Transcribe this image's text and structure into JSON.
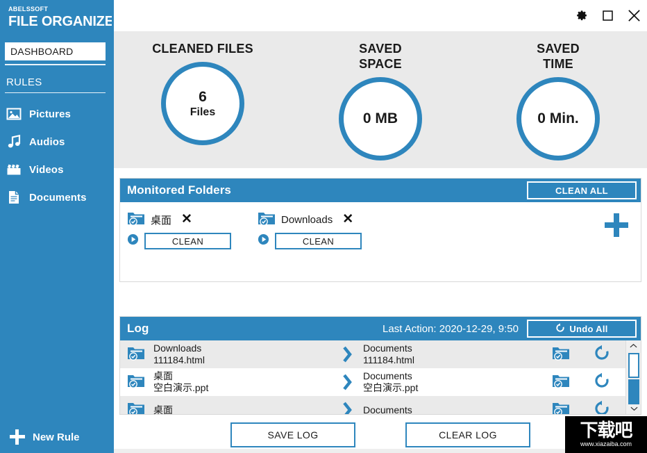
{
  "brand": {
    "small": "ABELSSOFT",
    "big": "FILE ORGANIZER"
  },
  "sidebar": {
    "dashboard_label": "DASHBOARD",
    "rules_label": "RULES",
    "items": [
      {
        "label": "Pictures",
        "icon": "picture-icon"
      },
      {
        "label": "Audios",
        "icon": "music-note-icon"
      },
      {
        "label": "Videos",
        "icon": "clapperboard-icon"
      },
      {
        "label": "Documents",
        "icon": "document-icon"
      }
    ],
    "new_rule_label": "New Rule"
  },
  "titlebar": {
    "settings_icon": "gear-icon",
    "maximize_icon": "square-icon",
    "close_icon": "close-icon"
  },
  "stats": [
    {
      "title": "CLEANED FILES",
      "value": "6",
      "unit": "Files"
    },
    {
      "title": "SAVED\nSPACE",
      "title_line1": "SAVED",
      "title_line2": "SPACE",
      "value": "0 MB",
      "unit": ""
    },
    {
      "title": "SAVED\nTIME",
      "title_line1": "SAVED",
      "title_line2": "TIME",
      "value": "0 Min.",
      "unit": ""
    }
  ],
  "monitored": {
    "title": "Monitored Folders",
    "clean_all_label": "CLEAN ALL",
    "add_icon": "plus-icon",
    "folders": [
      {
        "name": "桌面",
        "clean_label": "CLEAN",
        "remove_label": "✕",
        "play_icon": "play-icon",
        "folder_icon": "folder-check-icon"
      },
      {
        "name": "Downloads",
        "clean_label": "CLEAN",
        "remove_label": "✕",
        "play_icon": "play-icon",
        "folder_icon": "folder-check-icon"
      }
    ]
  },
  "log": {
    "title": "Log",
    "last_action": "Last Action: 2020-12-29, 9:50",
    "undo_all_label": "Undo All",
    "undo_icon": "undo-icon",
    "rows": [
      {
        "source_folder": "Downloads",
        "source_file": "111184.html",
        "target_folder": "Documents",
        "target_file": "111184.html",
        "arrow_icon": "chevron-right-icon",
        "folder_icon": "folder-check-icon",
        "revert_icon": "revert-icon"
      },
      {
        "source_folder": "桌面",
        "source_file": "空白演示.ppt",
        "target_folder": "Documents",
        "target_file": "空白演示.ppt",
        "arrow_icon": "chevron-right-icon",
        "folder_icon": "folder-check-icon",
        "revert_icon": "revert-icon"
      },
      {
        "source_folder": "桌面",
        "source_file": "",
        "target_folder": "Documents",
        "target_file": "",
        "arrow_icon": "chevron-right-icon",
        "folder_icon": "folder-check-icon",
        "revert_icon": "revert-icon"
      }
    ],
    "scroll_up_icon": "chevron-up-icon",
    "scroll_down_icon": "chevron-down-icon"
  },
  "footer": {
    "save_log_label": "SAVE LOG",
    "clear_log_label": "CLEAR LOG"
  },
  "watermark": {
    "text_cn": "下载吧",
    "url": "www.xiazaiba.com"
  },
  "colors": {
    "brand_blue": "#2e86bd",
    "panel_grey": "#eaeaea",
    "white": "#ffffff",
    "text_dark": "#1a1a1a"
  }
}
